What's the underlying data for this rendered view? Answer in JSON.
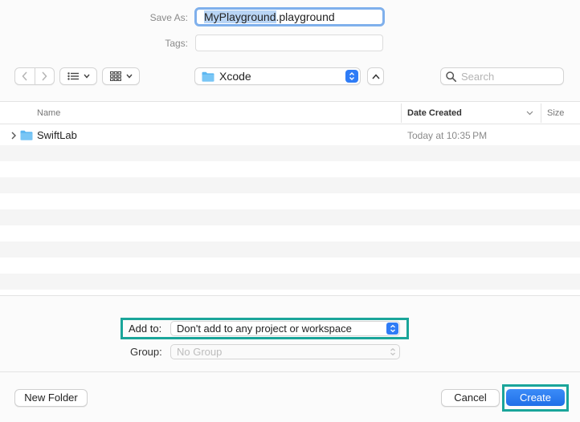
{
  "save_as": {
    "label": "Save As:",
    "filename_selected": "MyPlayground",
    "filename_ext": ".playground"
  },
  "tags": {
    "label": "Tags:",
    "value": ""
  },
  "toolbar": {
    "location": "Xcode",
    "search_placeholder": "Search"
  },
  "list": {
    "columns": {
      "name": "Name",
      "date_created": "Date Created",
      "size": "Size"
    },
    "rows": [
      {
        "name": "SwiftLab",
        "date_created": "Today at 10:35 PM",
        "kind": "folder"
      }
    ]
  },
  "options": {
    "add_to_label": "Add to:",
    "add_to_value": "Don't add to any project or workspace",
    "group_label": "Group:",
    "group_value": "No Group"
  },
  "buttons": {
    "new_folder": "New Folder",
    "cancel": "Cancel",
    "create": "Create"
  },
  "colors": {
    "accent": "#2f7cf6",
    "highlight": "#1aa59a",
    "folder": "#5db7f1"
  }
}
